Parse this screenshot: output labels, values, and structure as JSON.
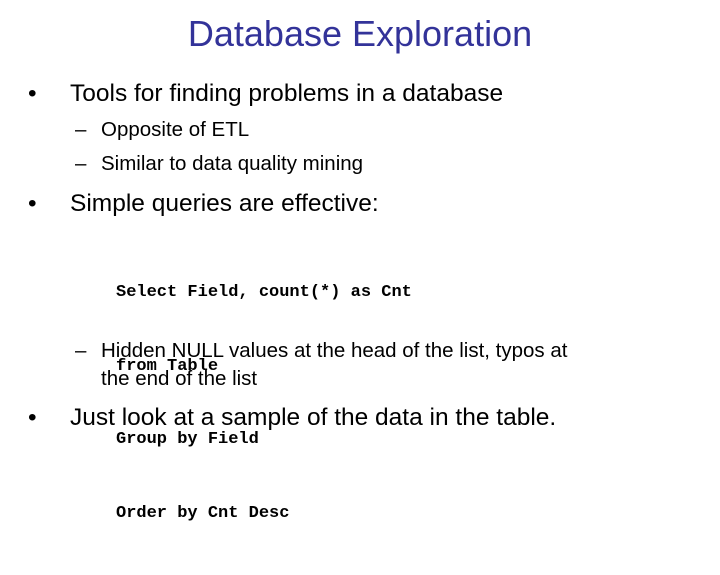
{
  "slide": {
    "title": "Database Exploration",
    "title_color": "#333399",
    "bullets": [
      {
        "marker": "•",
        "text": "Tools for finding problems in a database",
        "sub": [
          {
            "marker": "–",
            "text": "Opposite of ETL"
          },
          {
            "marker": "–",
            "text": "Similar to data quality mining"
          }
        ]
      },
      {
        "marker": "•",
        "text": "Simple queries are effective:",
        "code": [
          "Select Field, count(*) as Cnt",
          "from Table",
          "Group by Field",
          "Order by Cnt Desc"
        ],
        "sub": [
          {
            "marker": "–",
            "text_line1": "Hidden NULL values at the head of the list, typos at",
            "text_line2": "the end of the list"
          }
        ]
      },
      {
        "marker": "•",
        "text": "Just look at a sample of the data in the table."
      }
    ]
  }
}
